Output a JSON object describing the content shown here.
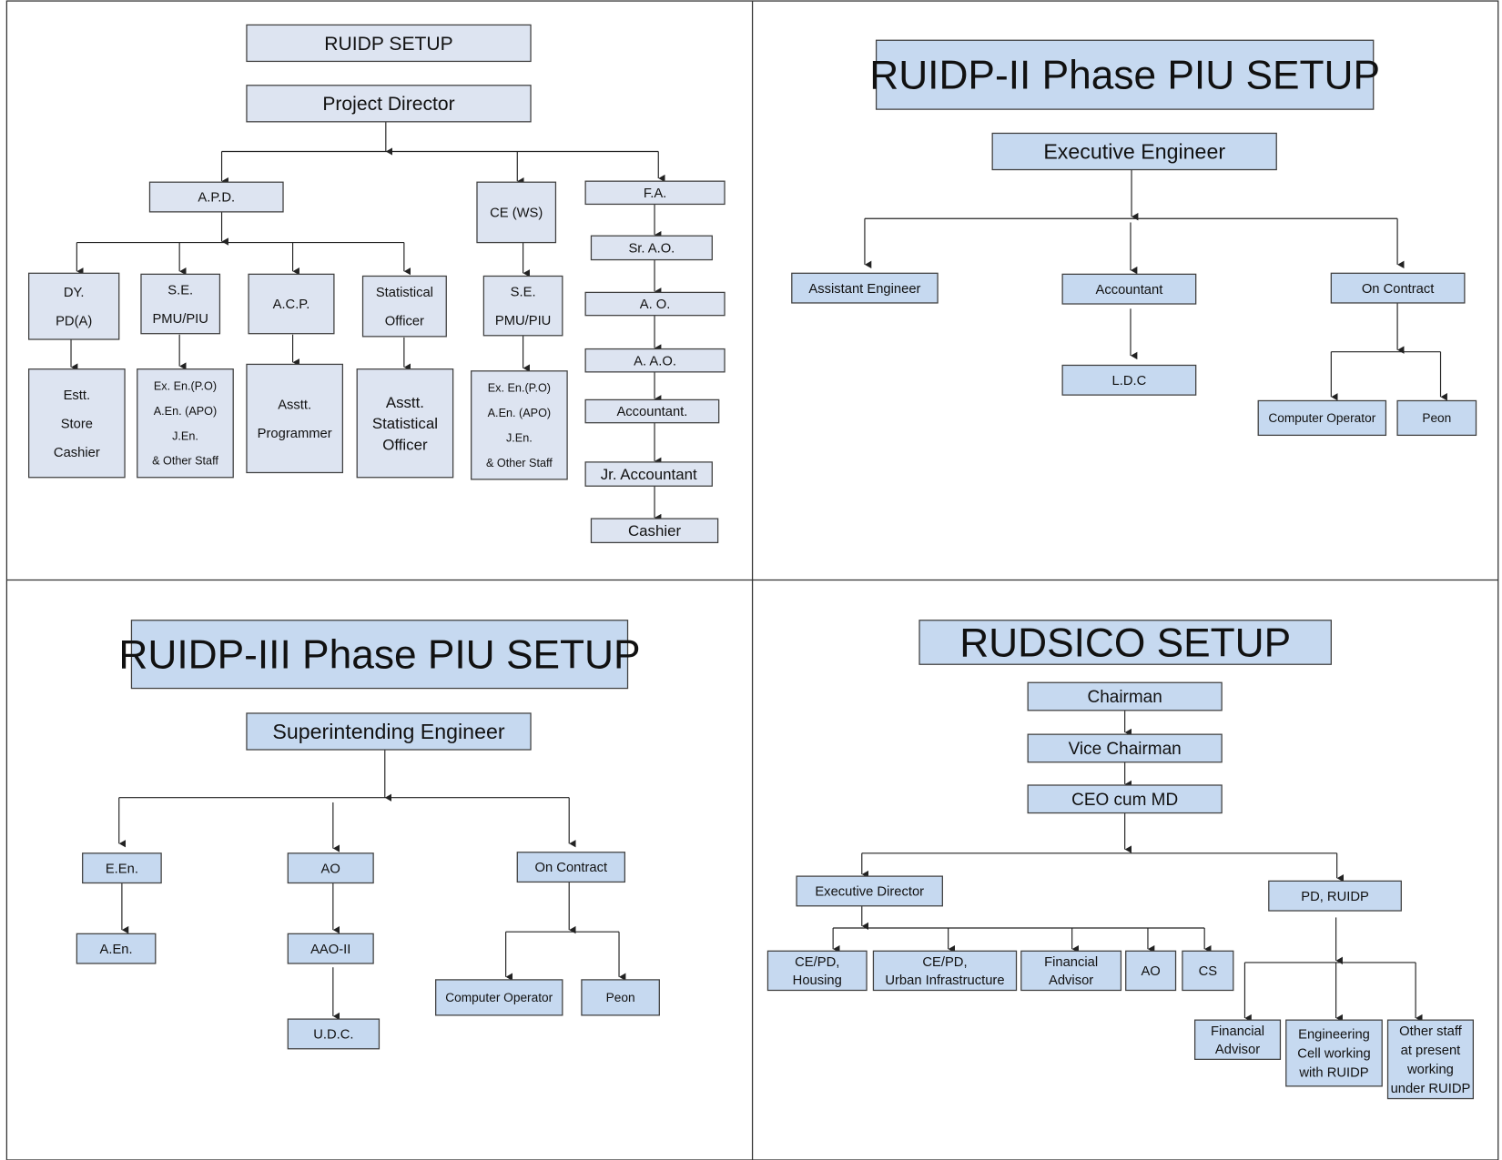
{
  "colors": {
    "box_fill_light": "#dde4f1",
    "box_fill_blue": "#c6d9f0",
    "box_stroke": "#404040",
    "line": "#222222"
  },
  "panels": {
    "ruidp": {
      "title": "RUIDP SETUP",
      "project_director": "Project Director",
      "apd": "A.P.D.",
      "ce_ws": "CE (WS)",
      "fa": "F.A.",
      "dy_pd": [
        "DY.",
        "PD(A)"
      ],
      "se_pmu": [
        "S.E.",
        "PMU/PIU"
      ],
      "acp": "A.C.P.",
      "stat_officer": [
        "Statistical",
        "Officer"
      ],
      "se_pmu_ws": [
        "S.E.",
        "PMU/PIU"
      ],
      "estt": [
        "Estt.",
        "Store",
        "Cashier"
      ],
      "exen_staff": [
        "Ex. En.(P.O)",
        "A.En. (APO)",
        "J.En.",
        "& Other Staff"
      ],
      "asst_programmer": [
        "Asstt.",
        "Programmer"
      ],
      "asst_stat_officer": [
        "Asstt.",
        "Statistical",
        "Officer"
      ],
      "exen_staff_ws": [
        "Ex. En.(P.O)",
        "A.En. (APO)",
        "J.En.",
        "& Other Staff"
      ],
      "finance_chain": [
        "Sr. A.O.",
        "A. O.",
        "A. A.O.",
        "Accountant.",
        "Jr. Accountant",
        "Cashier"
      ]
    },
    "ruidp2": {
      "title": "RUIDP-II Phase PIU SETUP",
      "executive_engineer": "Executive Engineer",
      "assistant_engineer": "Assistant Engineer",
      "accountant": "Accountant",
      "on_contract": "On Contract",
      "ldc": "L.D.C",
      "computer_operator": "Computer Operator",
      "peon": "Peon"
    },
    "ruidp3": {
      "title": "RUIDP-III Phase PIU SETUP",
      "superintending_engineer": "Superintending Engineer",
      "een": "E.En.",
      "ao": "AO",
      "on_contract": "On Contract",
      "aen": "A.En.",
      "aao2": "AAO-II",
      "udc": "U.D.C.",
      "computer_operator": "Computer Operator",
      "peon": "Peon"
    },
    "rudsico": {
      "title": "RUDSICO SETUP",
      "chairman": "Chairman",
      "vice_chairman": "Vice Chairman",
      "ceo": "CEO cum MD",
      "executive_director": "Executive Director",
      "pd_ruidp": "PD, RUIDP",
      "ce_housing": [
        "CE/PD,",
        "Housing"
      ],
      "ce_urban": [
        "CE/PD,",
        "Urban Infrastructure"
      ],
      "financial_advisor": [
        "Financial",
        "Advisor"
      ],
      "ao": "AO",
      "cs": "CS",
      "fa_ruidp": [
        "Financial",
        "Advisor"
      ],
      "engineering_cell": [
        "Engineering",
        "Cell working",
        "with RUIDP"
      ],
      "other_staff": [
        "Other staff",
        "at present",
        "working",
        "under RUIDP"
      ]
    }
  }
}
